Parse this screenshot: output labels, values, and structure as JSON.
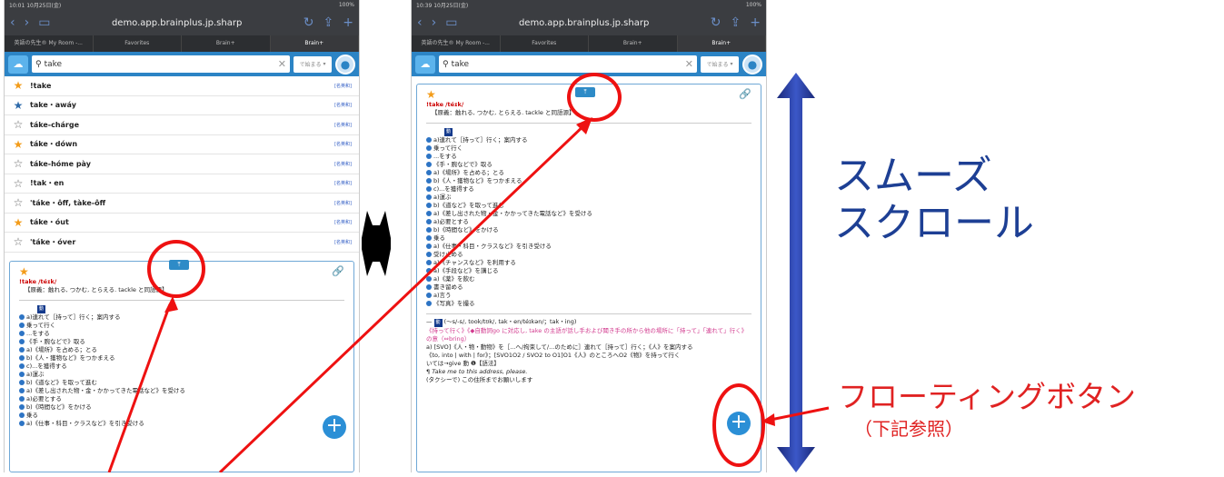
{
  "screens": [
    {
      "status_time": "10:01",
      "status_date": "10月25日(金)",
      "status_right": "100%",
      "url": "demo.app.brainplus.jp.sharp",
      "tabs": [
        "英語の先生® My Room -...",
        "Favorites",
        "Brain+",
        "Brain+"
      ],
      "search_value": "take",
      "select_label": "で始まる",
      "rows": [
        {
          "word": "!take",
          "star": "filled-orange",
          "tag": "[名英和]"
        },
        {
          "word": "take・awáy",
          "star": "filled-blue",
          "tag": "[名英和]"
        },
        {
          "word": "táke-chárge",
          "star": "empty",
          "tag": "[名英和]"
        },
        {
          "word": "táke・dówn",
          "star": "filled-orange",
          "tag": "[名英和]"
        },
        {
          "word": "táke-hóme pày",
          "star": "empty",
          "tag": "[名英和]"
        },
        {
          "word": "!tak・en",
          "star": "empty",
          "tag": "[名英和]"
        },
        {
          "word": "'táke・ôff, tàke-ôff",
          "star": "empty",
          "tag": "[名英和]"
        },
        {
          "word": "táke・óut",
          "star": "filled-orange",
          "tag": "[名英和]"
        },
        {
          "word": "'táke・óver",
          "star": "empty",
          "tag": "[名英和]"
        }
      ]
    },
    {
      "status_time": "10:39",
      "status_date": "10月25日(金)",
      "status_right": "100%",
      "url": "demo.app.brainplus.jp.sharp",
      "tabs": [
        "英語の先生® My Room -...",
        "Favorites",
        "Brain+",
        "Brain+"
      ],
      "search_value": "take",
      "select_label": "で始まる"
    }
  ],
  "entry": {
    "headword": "!take",
    "pron": "/téɪk/",
    "core": "【原義：触れる, つかむ, とらえる. tackle と同語源】",
    "pos_tag": "動",
    "senses": [
      "a)連れて［持って］行く；案内する",
      "乗って行く",
      "...をする",
      "《手・腕などで》取る",
      "a)《場所》を占める；とる",
      "b)《人・獲物など》をつかまえる",
      "c)...を獲得する",
      "a)運ぶ",
      "b)《道など》を取って進む",
      "a)《差し出された物・金・かかってきた電話など》を受ける",
      "a)必要とする",
      "b)《時間など》をかける",
      "乗る",
      "a)《仕事・科目・クラスなど》を引き受ける",
      "受け止める",
      "a)《チャンスなど》を利用する",
      "a)《手段など》を講じる",
      "a)《薬》を飲む",
      "書き留める",
      "a)言う",
      "《写真》を撮る"
    ],
    "forms": "(～s/-s/, took/tʊk/, tak・en/téɪkən/；tak・ing)",
    "pink1": "《持って行く》《◆自動詞go に対応し, take の主語が話し手および聞き手の所から他の場所に「持って」「連れて」行く》の意（⇔bring）",
    "line_a": "a) [SVO]《人・物・動物》を［...へ/拘束して/...のために］連れて［持って］行く；《人》を案内する",
    "line_b": "《to, into | with | for》；[SVO1O2 / SVO2 to O1]O1《人》のところへO2《物》を持って行く",
    "line_c": "いては→give 動 ❶【語法】",
    "ex1": "Take me to this address, please.",
    "ex1_ja": "(タクシーで) この住所までお願いします"
  },
  "annotations": {
    "smooth_line1": "スムーズ",
    "smooth_line2": "スクロール",
    "floating": "フローティングボタン",
    "floating_note": "（下記参照）"
  }
}
